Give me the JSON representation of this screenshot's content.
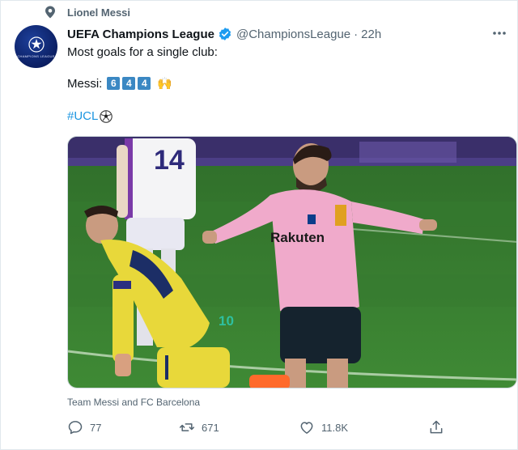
{
  "social_context": {
    "label": "Lionel Messi",
    "icon": "pin-icon"
  },
  "author": {
    "avatar_text": "CHAMPIONS LEAGUE",
    "name": "UEFA Champions League",
    "verified": true,
    "handle": "@ChampionsLeague",
    "separator": "·",
    "time": "22h"
  },
  "body": {
    "line1": "Most goals for a single club:",
    "line2_prefix": "Messi:",
    "digits": [
      "6",
      "4",
      "4"
    ],
    "emoji": "🙌",
    "hashtag": "#UCL"
  },
  "media": {
    "player_number": "14",
    "shirt_sponsor": "Rakuten",
    "shorts_number": "10",
    "caption": "Team Messi and FC Barcelona"
  },
  "actions": {
    "reply_count": "77",
    "retweet_count": "671",
    "like_count": "11.8K"
  },
  "colors": {
    "accent": "#1b95e0",
    "keycap": "#3b88c3",
    "secondary_text": "#536471"
  }
}
